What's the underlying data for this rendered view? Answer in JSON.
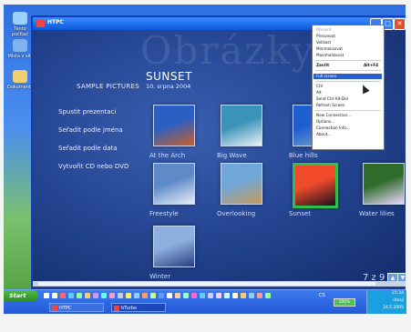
{
  "window": {
    "title": "HTPC"
  },
  "desktop_icons": [
    {
      "label": "Tento počítač",
      "color": "#9ad0ff"
    },
    {
      "label": "Místa v síti",
      "color": "#7fb2ef"
    },
    {
      "label": "Dokumenty",
      "color": "#f0d070"
    }
  ],
  "gallery": {
    "watermark": "Obrázky",
    "section_title": "SAMPLE PICTURES",
    "heading": "SUNSET",
    "date": "10. srpna 2004",
    "sidebar": [
      {
        "label": "Spustit prezentaci"
      },
      {
        "label": "Seřadit podle jména"
      },
      {
        "label": "Seřadit podle data"
      },
      {
        "label": "Vytvořit CD nebo DVD"
      }
    ],
    "photos": [
      {
        "caption": "At the Arch",
        "colors": [
          "#2b5fc4",
          "#c7602a"
        ]
      },
      {
        "caption": "Big Wave",
        "colors": [
          "#3a93b8",
          "#e8f2f5"
        ]
      },
      {
        "caption": "Blue hills",
        "colors": [
          "#1e5fd0",
          "#7aa0c8"
        ]
      },
      {
        "caption": "Freestyle",
        "colors": [
          "#5f8ac8",
          "#e6eefa"
        ]
      },
      {
        "caption": "Overlooking",
        "colors": [
          "#6fa7d8",
          "#c89a5a"
        ]
      },
      {
        "caption": "Sunset",
        "colors": [
          "#f04a2a",
          "#1b1020"
        ]
      },
      {
        "caption": "Water lilies",
        "colors": [
          "#2f6b2a",
          "#e8d8f8"
        ]
      },
      {
        "caption": "Winter",
        "colors": [
          "#8db0e0",
          "#2a3f80"
        ]
      }
    ],
    "page_indicator": "7 z 9"
  },
  "context_menu": {
    "items": [
      {
        "label": "Obnovit",
        "disabled": true
      },
      {
        "label": "Přesunout",
        "disabled": false
      },
      {
        "label": "Velikost",
        "disabled": false
      },
      {
        "label": "Minimalizovat",
        "disabled": false
      },
      {
        "label": "Maximalizovat",
        "disabled": false
      },
      {
        "label": "Zavřít",
        "shortcut": "Alt+F4",
        "disabled": false
      },
      {
        "label": "Full screen",
        "highlighted": true
      },
      {
        "label": "Ctrl"
      },
      {
        "label": "Alt"
      },
      {
        "label": "Send Ctrl-Alt-Del"
      },
      {
        "label": "Refresh Screen"
      },
      {
        "label": "New Connection..."
      },
      {
        "label": "Options..."
      },
      {
        "label": "Connection Info..."
      },
      {
        "label": "About..."
      }
    ]
  },
  "taskbar": {
    "start_label": "Start",
    "language": "CS",
    "battery": "100%",
    "tasks": [
      {
        "label": "HTPC",
        "active": false
      },
      {
        "label": "bTurbo",
        "active": true
      }
    ],
    "clock_lines": [
      "21:34",
      "úterý",
      "24.5.2005"
    ]
  }
}
